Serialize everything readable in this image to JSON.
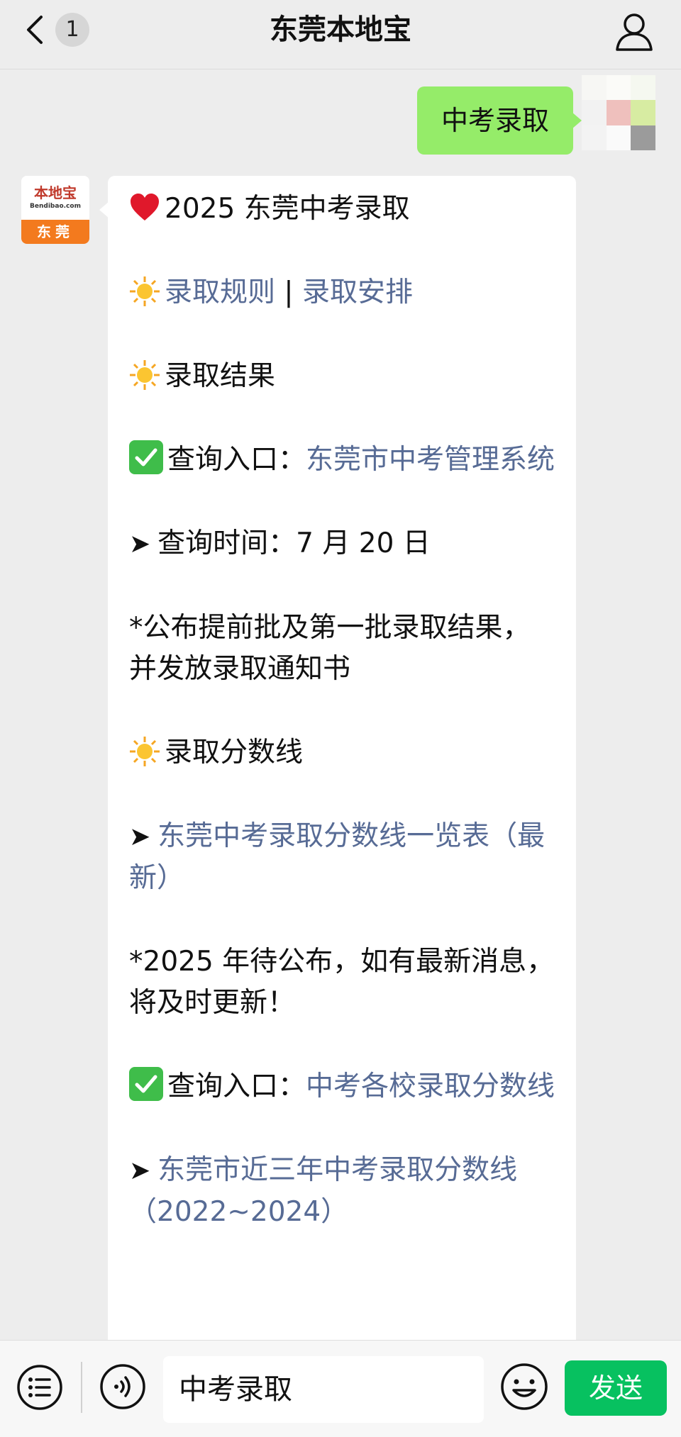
{
  "header": {
    "title": "东莞本地宝",
    "badge_count": "1"
  },
  "user_message": {
    "text": "中考录取"
  },
  "bot_avatar": {
    "brand": "本地宝",
    "domain": "Bendibao.com",
    "city": "东莞"
  },
  "bot_message": {
    "title_line": "2025 东莞中考录取",
    "rules_link": "录取规则",
    "separator": " | ",
    "arrangement_link": "录取安排",
    "result_heading": "录取结果",
    "query_entry_label": "查询入口：",
    "query_entry_link": "东莞市中考管理系统",
    "query_time": "查询时间：7 月 20 日",
    "publish_note": "*公布提前批及第一批录取结果，并发放录取通知书",
    "score_heading": "录取分数线",
    "score_table_link": "东莞中考录取分数线一览表（最新）",
    "pending_note": "*2025 年待公布，如有最新消息，将及时更新！",
    "score_entry_label": "查询入口：",
    "score_entry_link": "中考各校录取分数线",
    "three_year_link": "东莞市近三年中考录取分数线（2022~2024）"
  },
  "input_bar": {
    "input_value": "中考录取",
    "send_label": "发送"
  },
  "colors": {
    "background": "#ededed",
    "user_bubble": "#95ec69",
    "link": "#576b95",
    "send_button": "#07c160"
  }
}
